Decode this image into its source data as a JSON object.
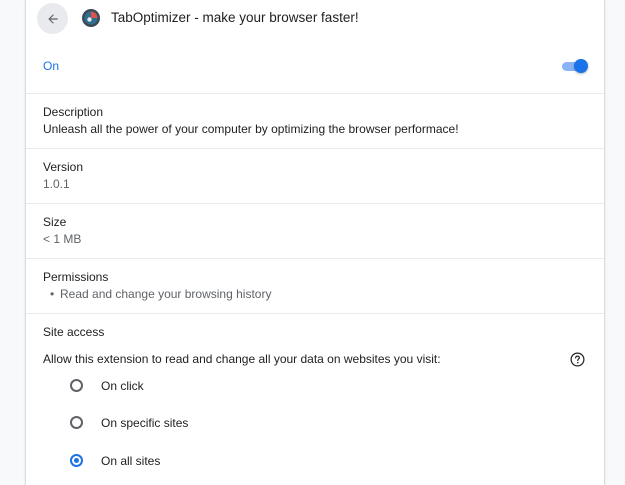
{
  "header": {
    "title": "TabOptimizer - make your browser faster!",
    "back_icon": "arrow-back-icon",
    "extension_icon": "extension-logo-icon"
  },
  "enabled": {
    "label": "On",
    "state": true,
    "accent_color": "#1a73e8"
  },
  "description": {
    "label": "Description",
    "value": "Unleash all the power of your computer by optimizing the browser performace!"
  },
  "version": {
    "label": "Version",
    "value": "1.0.1"
  },
  "size": {
    "label": "Size",
    "value": "< 1 MB"
  },
  "permissions": {
    "label": "Permissions",
    "items": [
      "Read and change your browsing history"
    ]
  },
  "site_access": {
    "label": "Site access",
    "description": "Allow this extension to read and change all your data on websites you visit:",
    "help_icon": "help-circle-icon",
    "options": [
      {
        "label": "On click",
        "selected": false
      },
      {
        "label": "On specific sites",
        "selected": false
      },
      {
        "label": "On all sites",
        "selected": true
      }
    ]
  }
}
